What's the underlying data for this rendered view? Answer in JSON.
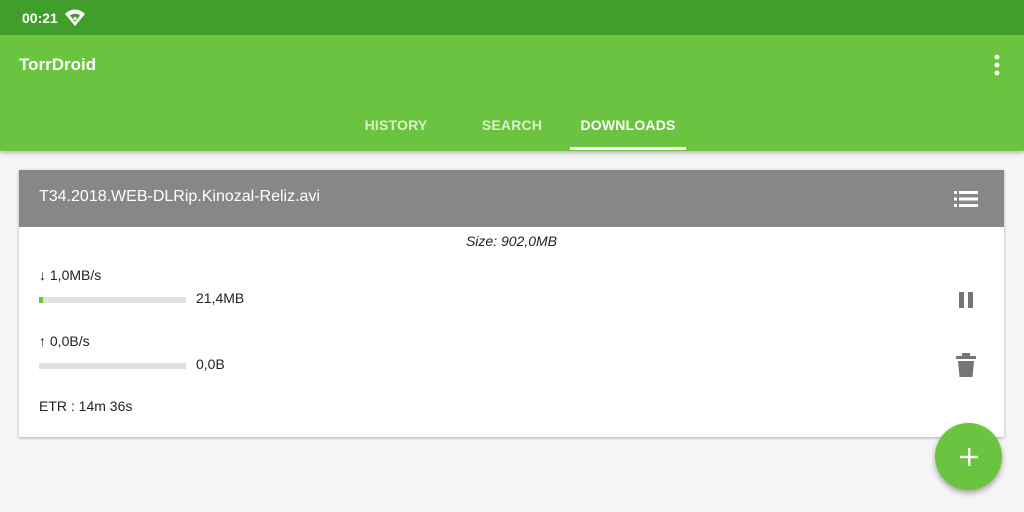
{
  "status_bar": {
    "time": "00:21",
    "wifi_icon": "wifi-icon"
  },
  "app_bar": {
    "title": "TorrDroid",
    "overflow_icon": "more-vert-icon",
    "tabs": [
      {
        "label": "HISTORY",
        "active": false
      },
      {
        "label": "SEARCH",
        "active": false
      },
      {
        "label": "DOWNLOADS",
        "active": true
      }
    ]
  },
  "download": {
    "file_name": "T34.2018.WEB-DLRip.Kinozal-Reliz.avi",
    "list_icon": "list-icon",
    "size": "Size: 902,0MB",
    "download_rate": "↓ 1,0MB/s",
    "downloaded": "21,4MB",
    "download_progress": 0.024,
    "upload_rate": "↑ 0,0B/s",
    "uploaded": "0,0B",
    "upload_progress": 0,
    "etr": "ETR : 14m 36s",
    "pause_icon": "pause-icon",
    "delete_icon": "delete-icon"
  },
  "fab": {
    "icon": "add-icon"
  },
  "colors": {
    "status_bar": "#3f9f2a",
    "app_bar": "#6ac43f",
    "card_header": "#878787",
    "accent": "#6ac43f"
  }
}
